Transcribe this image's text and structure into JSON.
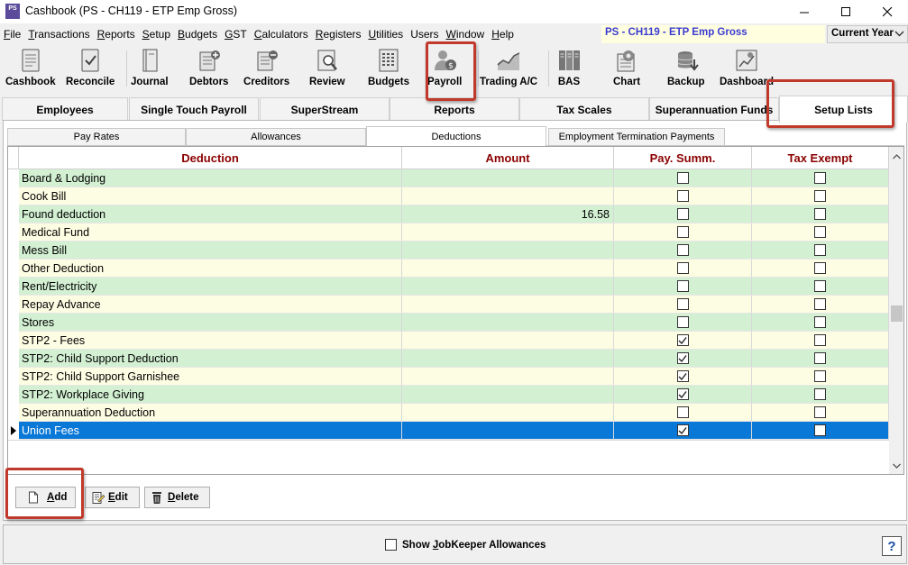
{
  "window": {
    "title": "Cashbook (PS - CH119 - ETP Emp Gross)",
    "app_icon_text": "PS",
    "company": "PS - CH119 - ETP Emp Gross",
    "year": "Current Year"
  },
  "menu": [
    {
      "u": "F",
      "rest": "ile"
    },
    {
      "u": "T",
      "rest": "ransactions"
    },
    {
      "u": "R",
      "rest": "eports"
    },
    {
      "u": "S",
      "rest": "etup"
    },
    {
      "u": "B",
      "rest": "udgets"
    },
    {
      "u": "G",
      "rest": "ST"
    },
    {
      "u": "C",
      "rest": "alculators"
    },
    {
      "u": "R",
      "rest": "egisters"
    },
    {
      "u": "U",
      "rest": "tilities"
    },
    {
      "u": "",
      "rest": "Users"
    },
    {
      "u": "W",
      "rest": "indow"
    },
    {
      "u": "H",
      "rest": "elp"
    }
  ],
  "toolbar": [
    {
      "label": "Cashbook",
      "icon": "cashbook-icon"
    },
    {
      "label": "Reconcile",
      "icon": "reconcile-icon"
    },
    {
      "label": "Journal",
      "icon": "journal-icon"
    },
    {
      "label": "Debtors",
      "icon": "debtors-icon"
    },
    {
      "label": "Creditors",
      "icon": "creditors-icon"
    },
    {
      "label": "Review",
      "icon": "review-icon"
    },
    {
      "label": "Budgets",
      "icon": "budgets-icon"
    },
    {
      "label": "Payroll",
      "icon": "payroll-icon"
    },
    {
      "label": "Trading A/C",
      "icon": "trading-icon"
    },
    {
      "label": "BAS",
      "icon": "bas-icon"
    },
    {
      "label": "Chart",
      "icon": "chart-icon"
    },
    {
      "label": "Backup",
      "icon": "backup-icon"
    },
    {
      "label": "Dashboard",
      "icon": "dashboard-icon"
    }
  ],
  "main_tabs": [
    "Employees",
    "Single Touch Payroll",
    "SuperStream",
    "Reports",
    "Tax Scales",
    "Superannuation Funds",
    "Setup Lists"
  ],
  "active_main_tab": "Setup Lists",
  "sub_tabs": [
    "Pay Rates",
    "Allowances",
    "Deductions",
    "Employment Termination Payments"
  ],
  "active_sub_tab": "Deductions",
  "grid": {
    "columns": [
      "Deduction",
      "Amount",
      "Pay. Summ.",
      "Tax Exempt"
    ],
    "rows": [
      {
        "deduction": "Board & Lodging",
        "amount": "",
        "pay_summ": false,
        "tax_exempt": false
      },
      {
        "deduction": "Cook Bill",
        "amount": "",
        "pay_summ": false,
        "tax_exempt": false
      },
      {
        "deduction": "Found deduction",
        "amount": "16.58",
        "pay_summ": false,
        "tax_exempt": false
      },
      {
        "deduction": "Medical Fund",
        "amount": "",
        "pay_summ": false,
        "tax_exempt": false
      },
      {
        "deduction": "Mess Bill",
        "amount": "",
        "pay_summ": false,
        "tax_exempt": false
      },
      {
        "deduction": "Other Deduction",
        "amount": "",
        "pay_summ": false,
        "tax_exempt": false
      },
      {
        "deduction": "Rent/Electricity",
        "amount": "",
        "pay_summ": false,
        "tax_exempt": false
      },
      {
        "deduction": "Repay Advance",
        "amount": "",
        "pay_summ": false,
        "tax_exempt": false
      },
      {
        "deduction": "Stores",
        "amount": "",
        "pay_summ": false,
        "tax_exempt": false
      },
      {
        "deduction": "STP2 - Fees",
        "amount": "",
        "pay_summ": true,
        "tax_exempt": false
      },
      {
        "deduction": "STP2: Child Support Deduction",
        "amount": "",
        "pay_summ": true,
        "tax_exempt": false
      },
      {
        "deduction": "STP2: Child Support Garnishee",
        "amount": "",
        "pay_summ": true,
        "tax_exempt": false
      },
      {
        "deduction": "STP2: Workplace Giving",
        "amount": "",
        "pay_summ": true,
        "tax_exempt": false
      },
      {
        "deduction": "Superannuation Deduction",
        "amount": "",
        "pay_summ": false,
        "tax_exempt": false
      },
      {
        "deduction": "Union Fees",
        "amount": "",
        "pay_summ": true,
        "tax_exempt": false,
        "selected": true
      }
    ]
  },
  "buttons": {
    "add": {
      "u": "A",
      "rest": "dd"
    },
    "edit": {
      "u": "E",
      "rest": "dit"
    },
    "delete": {
      "u": "D",
      "rest": "elete"
    }
  },
  "status": {
    "jobkeeper_pre": "Show ",
    "jobkeeper_u": "J",
    "jobkeeper_rest": "obKeeper Allowances",
    "jobkeeper_checked": false,
    "help": "?"
  },
  "colors": {
    "header_text": "#8b0000",
    "row_green": "#d3f0d3",
    "row_yellow": "#fdfde3",
    "selected_row": "#0a78d7",
    "highlight_box": "#c0392b",
    "company_text": "#3b3bd1"
  }
}
